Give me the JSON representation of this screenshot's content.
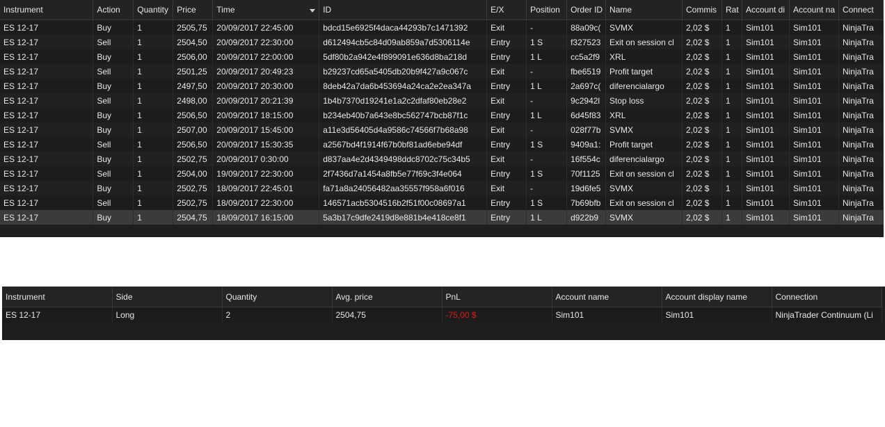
{
  "executions": {
    "columns": [
      "Instrument",
      "Action",
      "Quantity",
      "Price",
      "Time",
      "ID",
      "E/X",
      "Position",
      "Order ID",
      "Name",
      "Commis",
      "Rat",
      "Account di",
      "Account na",
      "Connect"
    ],
    "sort_column": "Time",
    "rows": [
      [
        "ES 12-17",
        "Buy",
        "1",
        "2505,75",
        "20/09/2017 22:45:00",
        "bdcd15e6925f4daca44293b7c1471392",
        "Exit",
        "-",
        "88a09c(",
        "SVMX",
        "2,02 $",
        "1",
        "Sim101",
        "Sim101",
        "NinjaTra"
      ],
      [
        "ES 12-17",
        "Sell",
        "1",
        "2504,50",
        "20/09/2017 22:30:00",
        "d612494cb5c84d09ab859a7d5306114e",
        "Entry",
        "1 S",
        "f327523",
        "Exit on session cl",
        "2,02 $",
        "1",
        "Sim101",
        "Sim101",
        "NinjaTra"
      ],
      [
        "ES 12-17",
        "Buy",
        "1",
        "2506,00",
        "20/09/2017 22:00:00",
        "5df80b2a942e4f899091e636d8ba218d",
        "Entry",
        "1 L",
        "cc5a2f9",
        "XRL",
        "2,02 $",
        "1",
        "Sim101",
        "Sim101",
        "NinjaTra"
      ],
      [
        "ES 12-17",
        "Sell",
        "1",
        "2501,25",
        "20/09/2017 20:49:23",
        "b29237cd65a5405db20b9f427a9c067c",
        "Exit",
        "-",
        "fbe6519",
        "Profit target",
        "2,02 $",
        "1",
        "Sim101",
        "Sim101",
        "NinjaTra"
      ],
      [
        "ES 12-17",
        "Buy",
        "1",
        "2497,50",
        "20/09/2017 20:30:00",
        "8deb42a7da6b453694a24ca2e2ea347a",
        "Entry",
        "1 L",
        "2a697c(",
        "diferencialargo",
        "2,02 $",
        "1",
        "Sim101",
        "Sim101",
        "NinjaTra"
      ],
      [
        "ES 12-17",
        "Sell",
        "1",
        "2498,00",
        "20/09/2017 20:21:39",
        "1b4b7370d19241e1a2c2dfaf80eb28e2",
        "Exit",
        "-",
        "9c2942l",
        "Stop loss",
        "2,02 $",
        "1",
        "Sim101",
        "Sim101",
        "NinjaTra"
      ],
      [
        "ES 12-17",
        "Buy",
        "1",
        "2506,50",
        "20/09/2017 18:15:00",
        "b234eb40b7a643e8bc562747bcb87f1c",
        "Entry",
        "1 L",
        "6d45f83",
        "XRL",
        "2,02 $",
        "1",
        "Sim101",
        "Sim101",
        "NinjaTra"
      ],
      [
        "ES 12-17",
        "Buy",
        "1",
        "2507,00",
        "20/09/2017 15:45:00",
        "a11e3d56405d4a9586c74566f7b68a98",
        "Exit",
        "-",
        "028f77b",
        "SVMX",
        "2,02 $",
        "1",
        "Sim101",
        "Sim101",
        "NinjaTra"
      ],
      [
        "ES 12-17",
        "Sell",
        "1",
        "2506,50",
        "20/09/2017 15:30:35",
        "a2567bd4f1914f67b0bf81ad6ebe94df",
        "Entry",
        "1 S",
        "9409a1:",
        "Profit target",
        "2,02 $",
        "1",
        "Sim101",
        "Sim101",
        "NinjaTra"
      ],
      [
        "ES 12-17",
        "Buy",
        "1",
        "2502,75",
        "20/09/2017 0:30:00",
        "d837aa4e2d4349498ddc8702c75c34b5",
        "Exit",
        "-",
        "16f554c",
        "diferencialargo",
        "2,02 $",
        "1",
        "Sim101",
        "Sim101",
        "NinjaTra"
      ],
      [
        "ES 12-17",
        "Sell",
        "1",
        "2504,00",
        "19/09/2017 22:30:00",
        "2f7436d7a1454a8fb5e77f69c3f4e064",
        "Entry",
        "1 S",
        "70f1125",
        "Exit on session cl",
        "2,02 $",
        "1",
        "Sim101",
        "Sim101",
        "NinjaTra"
      ],
      [
        "ES 12-17",
        "Buy",
        "1",
        "2502,75",
        "18/09/2017 22:45:01",
        "fa71a8a24056482aa35557f958a6f016",
        "Exit",
        "-",
        "19d6fe5",
        "SVMX",
        "2,02 $",
        "1",
        "Sim101",
        "Sim101",
        "NinjaTra"
      ],
      [
        "ES 12-17",
        "Sell",
        "1",
        "2502,75",
        "18/09/2017 22:30:00",
        "146571acb5304516b2f51f00c08697a1",
        "Entry",
        "1 S",
        "7b69bfb",
        "Exit on session cl",
        "2,02 $",
        "1",
        "Sim101",
        "Sim101",
        "NinjaTra"
      ],
      [
        "ES 12-17",
        "Buy",
        "1",
        "2504,75",
        "18/09/2017 16:15:00",
        "5a3b17c9dfe2419d8e881b4e418ce8f1",
        "Entry",
        "1 L",
        "d922b9",
        "SVMX",
        "2,02 $",
        "1",
        "Sim101",
        "Sim101",
        "NinjaTra"
      ]
    ],
    "selected_row": 13
  },
  "positions": {
    "columns": [
      "Instrument",
      "Side",
      "Quantity",
      "Avg. price",
      "PnL",
      "Account name",
      "Account display name",
      "Connection"
    ],
    "rows": [
      [
        "ES 12-17",
        "Long",
        "2",
        "2504,75",
        "-75,00 $",
        "Sim101",
        "Sim101",
        "NinjaTrader Continuum (Li"
      ]
    ],
    "negative_color": "#e01b1b"
  }
}
